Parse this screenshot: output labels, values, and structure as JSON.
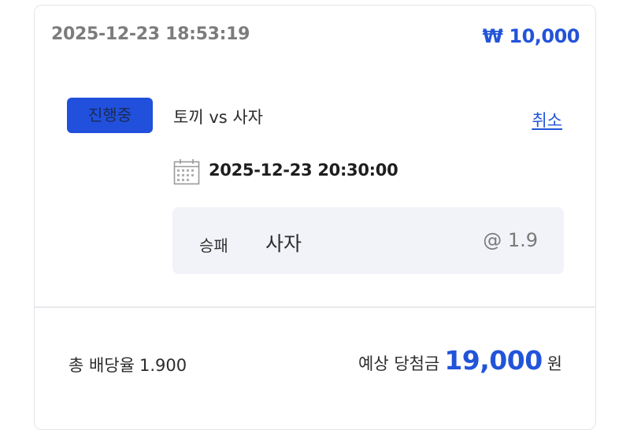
{
  "bet": {
    "placed_at": "2025-12-23 18:53:19",
    "stake": "₩ 10,000"
  },
  "match": {
    "status": "진행중",
    "title": "토끼 vs 사자",
    "cancel_label": "취소",
    "start_time": "2025-12-23 20:30:00"
  },
  "pick": {
    "market": "승패",
    "selection": "사자",
    "odds": "@ 1.9"
  },
  "summary": {
    "total_odds_label": "총 배당율",
    "total_odds_value": "1.900",
    "payout_label": "예상 당첨금",
    "payout_amount": "19,000",
    "payout_unit": "원"
  },
  "colors": {
    "accent": "#2254d9",
    "badge_bg": "#2150dd",
    "pick_bg": "#f1f3f8"
  },
  "icons": {
    "calendar": "calendar-icon"
  }
}
